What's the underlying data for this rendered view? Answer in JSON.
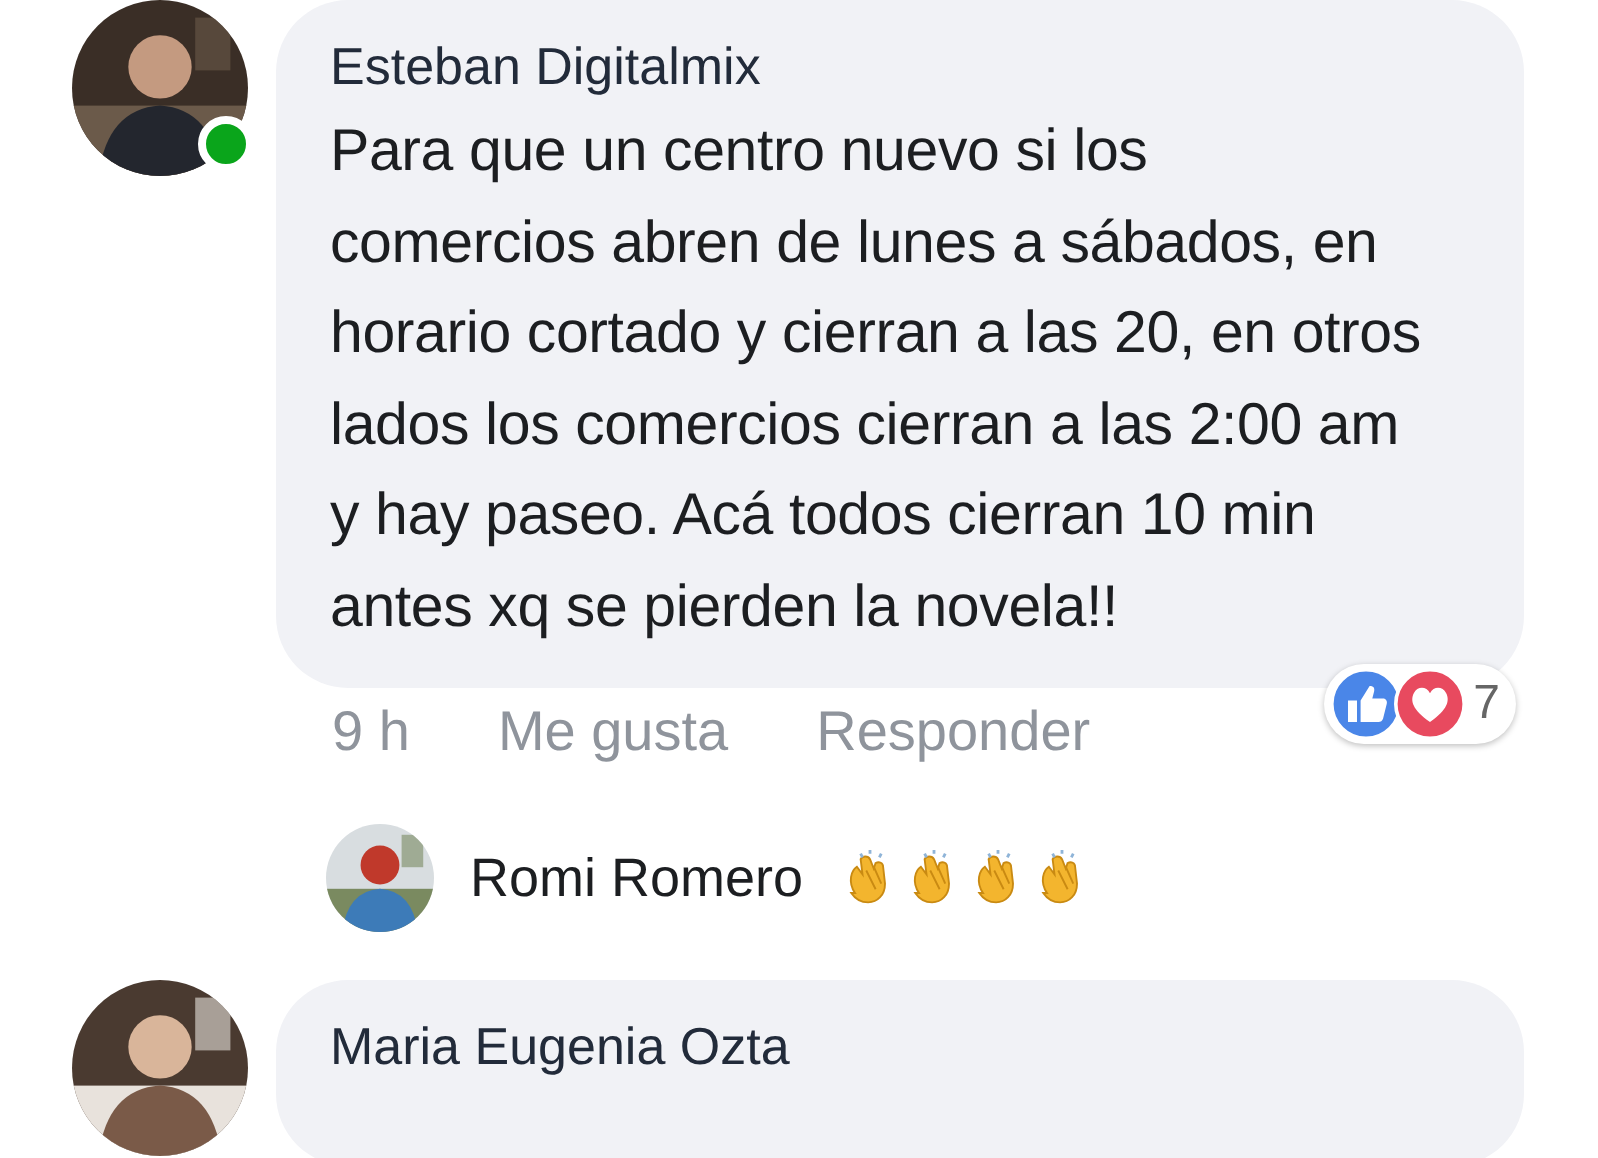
{
  "comments": [
    {
      "author": "Esteban Digitalmix",
      "online": true,
      "text": "Para que un centro nuevo si los comercios abren de lunes a sábados, en horario cortado y cierran a las 20, en otros lados los comercios cierran a las 2:00 am y hay paseo. Acá todos cierran 10 min antes xq se pierden la novela!!",
      "time": "9 h",
      "actions": [
        "Me gusta",
        "Responder"
      ],
      "reactions": {
        "icons": [
          {
            "kind": "like"
          },
          {
            "kind": "love"
          }
        ],
        "count": "7"
      },
      "reply_preview": {
        "author": "Romi Romero",
        "icons": [
          {
            "kind": "clap"
          },
          {
            "kind": "clap"
          },
          {
            "kind": "clap"
          },
          {
            "kind": "clap"
          }
        ]
      }
    },
    {
      "author": "Maria Eugenia Ozta"
    }
  ]
}
